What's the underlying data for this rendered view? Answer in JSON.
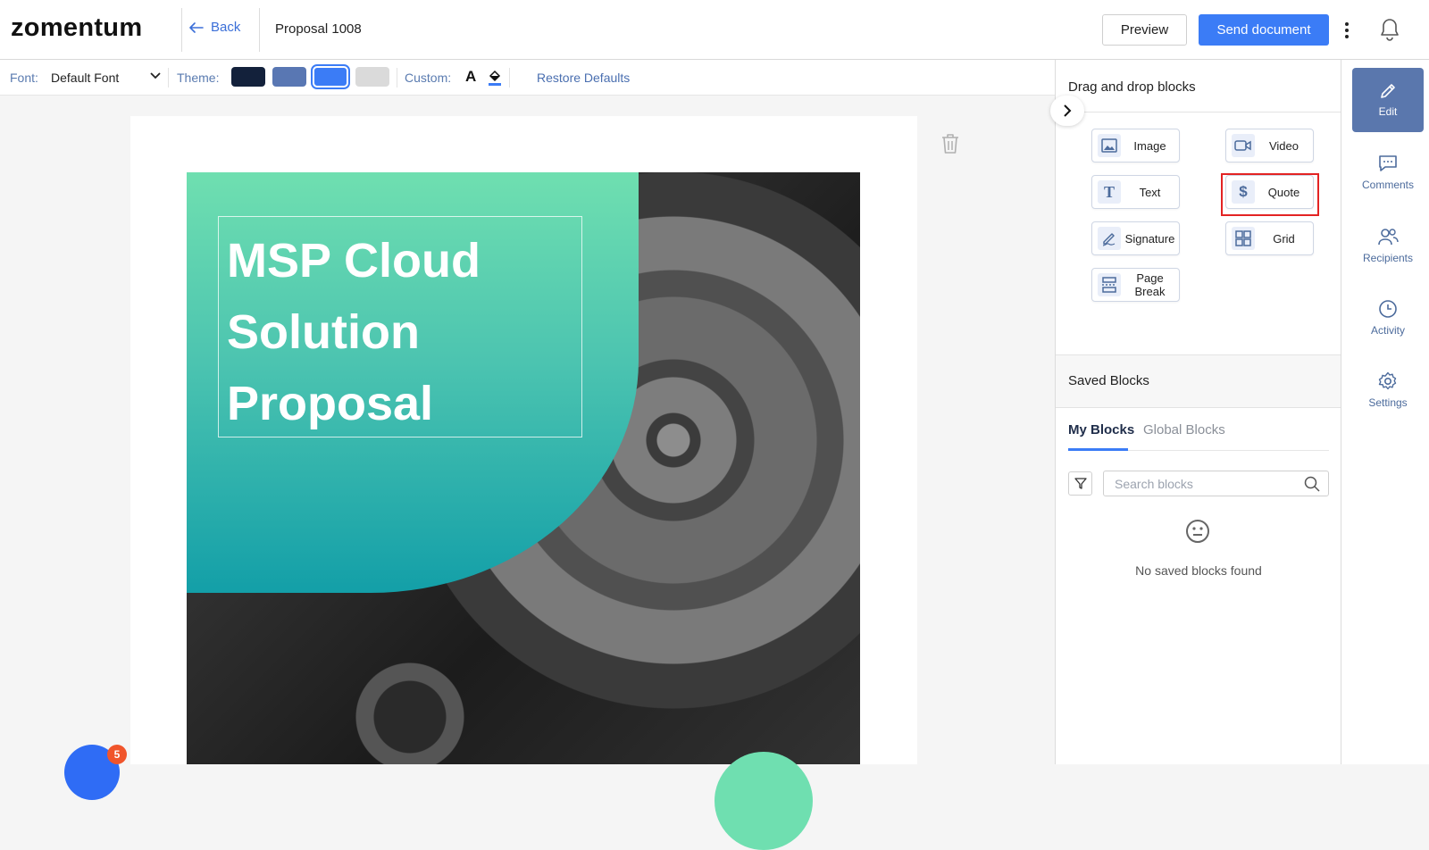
{
  "app": {
    "logo": "zomentum"
  },
  "header": {
    "back_label": "Back",
    "doc_title": "Proposal 1008",
    "preview_label": "Preview",
    "send_label": "Send document"
  },
  "toolbar": {
    "font_label": "Font:",
    "font_value": "Default Font",
    "theme_label": "Theme:",
    "theme_colors": [
      "#13213b",
      "#5977b3",
      "#3b7cf6",
      "#dadada"
    ],
    "selected_theme_index": 2,
    "custom_label": "Custom:",
    "restore_label": "Restore Defaults"
  },
  "document": {
    "title_line1": "MSP Cloud",
    "title_line2": "Solution",
    "title_line3": "Proposal",
    "badge_count": "5"
  },
  "panel": {
    "heading": "Drag and drop blocks",
    "blocks": [
      {
        "label": "Image",
        "icon": "image-icon"
      },
      {
        "label": "Video",
        "icon": "video-icon"
      },
      {
        "label": "Text",
        "icon": "text-icon"
      },
      {
        "label": "Quote",
        "icon": "dollar-icon"
      },
      {
        "label": "Signature",
        "icon": "signature-icon"
      },
      {
        "label": "Grid",
        "icon": "grid-icon"
      },
      {
        "label": "Page Break",
        "icon": "page-break-icon"
      }
    ],
    "saved_heading": "Saved Blocks",
    "tabs": [
      "My Blocks",
      "Global Blocks"
    ],
    "active_tab": "My Blocks",
    "search_placeholder": "Search blocks",
    "empty_message": "No saved blocks found"
  },
  "sidenav": {
    "items": [
      {
        "label": "Edit",
        "icon": "pencil-icon"
      },
      {
        "label": "Comments",
        "icon": "comments-icon"
      },
      {
        "label": "Recipients",
        "icon": "recipients-icon"
      },
      {
        "label": "Activity",
        "icon": "clock-icon"
      },
      {
        "label": "Settings",
        "icon": "gear-icon"
      }
    ],
    "active": "Edit"
  },
  "colors": {
    "accent": "#3b7cf6",
    "highlight": "#e32323",
    "hero_top": "#6fdfb0",
    "hero_bottom": "#139fa8"
  }
}
